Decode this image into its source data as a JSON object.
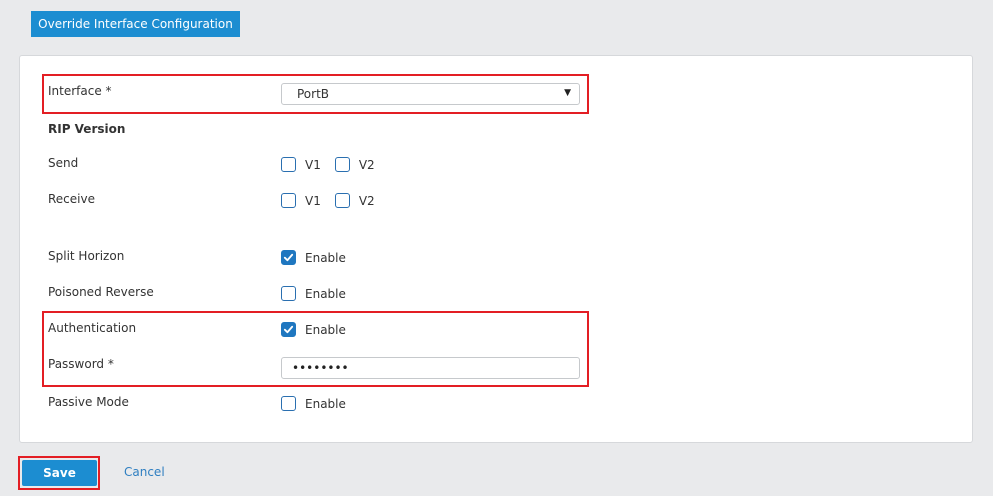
{
  "header": {
    "title": "Override Interface Configuration"
  },
  "form": {
    "interface_label": "Interface *",
    "interface_value": "PortB",
    "rip_version_title": "RIP Version",
    "send_label": "Send",
    "receive_label": "Receive",
    "v1_label": "V1",
    "v2_label": "V2",
    "split_horizon_label": "Split Horizon",
    "poisoned_reverse_label": "Poisoned Reverse",
    "authentication_label": "Authentication",
    "password_label": "Password *",
    "password_value": "••••••••",
    "passive_mode_label": "Passive Mode",
    "enable_label": "Enable",
    "checkboxes": {
      "send_v1": false,
      "send_v2": false,
      "receive_v1": false,
      "receive_v2": false,
      "split_horizon": true,
      "poisoned_reverse": false,
      "authentication": true,
      "passive_mode": false
    }
  },
  "footer": {
    "save_label": "Save",
    "cancel_label": "Cancel"
  },
  "colors": {
    "accent": "#1c8dd1",
    "highlight": "#e31e24",
    "checkbox": "#1f77c0"
  }
}
